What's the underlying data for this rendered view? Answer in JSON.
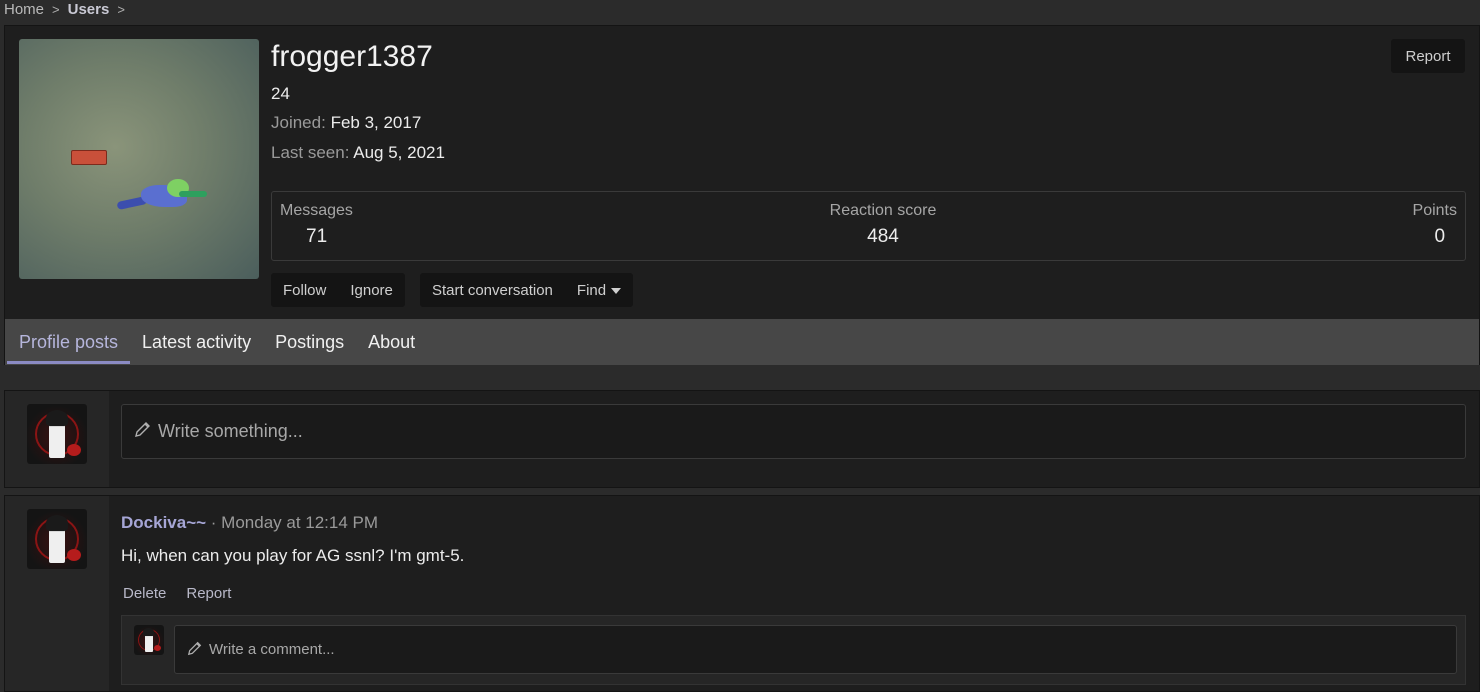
{
  "breadcrumb": {
    "home": "Home",
    "users": "Users",
    "sep": ">"
  },
  "profile": {
    "username": "frogger1387",
    "title": "24",
    "joined_label": "Joined:",
    "joined_value": "Feb 3, 2017",
    "last_seen_label": "Last seen:",
    "last_seen_value": "Aug 5, 2021",
    "report_label": "Report",
    "stats": {
      "messages_label": "Messages",
      "messages_value": "71",
      "reaction_label": "Reaction score",
      "reaction_value": "484",
      "points_label": "Points",
      "points_value": "0"
    },
    "actions": {
      "follow": "Follow",
      "ignore": "Ignore",
      "start_conversation": "Start conversation",
      "find": "Find"
    }
  },
  "tabs": [
    {
      "label": "Profile posts",
      "active": true
    },
    {
      "label": "Latest activity",
      "active": false
    },
    {
      "label": "Postings",
      "active": false
    },
    {
      "label": "About",
      "active": false
    }
  ],
  "compose": {
    "placeholder": "Write something..."
  },
  "message": {
    "author": "Dockiva~~",
    "separator": " · ",
    "time": "Monday at 12:14 PM",
    "body": "Hi, when can you play for AG ssnl? I'm gmt-5.",
    "delete_label": "Delete",
    "report_label": "Report",
    "comment_placeholder": "Write a comment..."
  },
  "colors": {
    "accent": "#8b8bc4",
    "author": "#a6a6d6",
    "card_bg": "#1e1e1e",
    "page_bg": "#2b2b2b"
  },
  "icons": {
    "pencil": "pencil-icon",
    "caret": "caret-down-icon",
    "chevron": "chevron-right-icon"
  }
}
